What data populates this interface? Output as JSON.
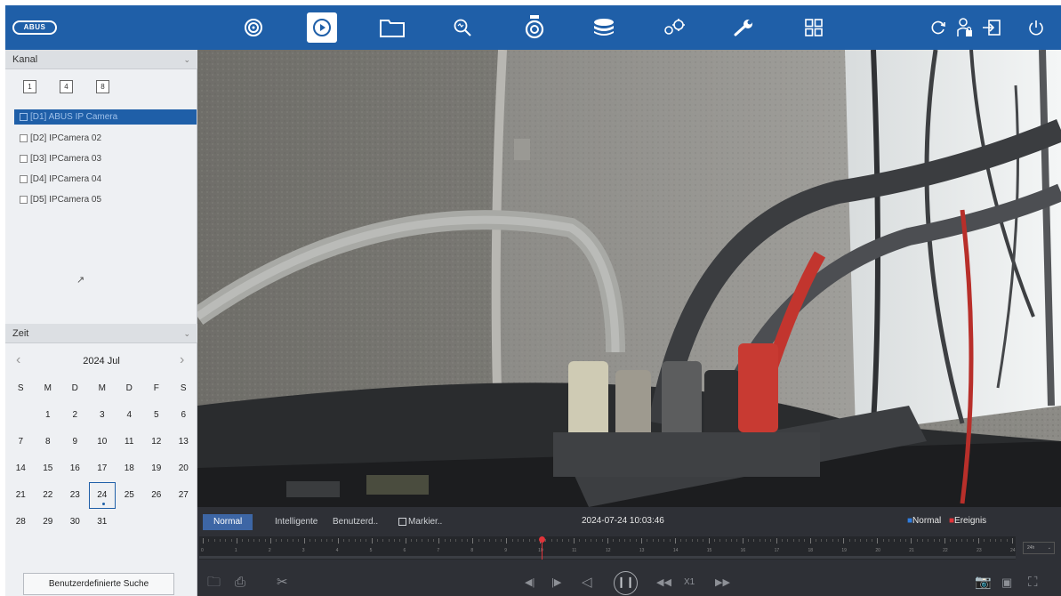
{
  "app": {
    "logo_text": "ABUS"
  },
  "topbar": {
    "icons": [
      {
        "name": "live-view-icon"
      },
      {
        "name": "playback-icon",
        "active": true
      },
      {
        "name": "file-manager-icon"
      },
      {
        "name": "search-icon"
      },
      {
        "name": "camera-icon"
      },
      {
        "name": "storage-icon"
      },
      {
        "name": "settings-icon"
      },
      {
        "name": "maintenance-icon"
      },
      {
        "name": "layout-icon"
      },
      {
        "name": "refresh-icon"
      },
      {
        "name": "user-lock-icon"
      },
      {
        "name": "logout-icon"
      },
      {
        "name": "power-icon"
      }
    ]
  },
  "sidebar": {
    "channel_section": {
      "title": "Kanal",
      "layout_buttons": [
        "1",
        "4",
        "8"
      ],
      "cameras": [
        {
          "label": "[D1] ABUS IP Camera",
          "selected": true
        },
        {
          "label": "[D2] IPCamera 02",
          "selected": false
        },
        {
          "label": "[D3] IPCamera 03",
          "selected": false
        },
        {
          "label": "[D4] IPCamera 04",
          "selected": false
        },
        {
          "label": "[D5] IPCamera 05",
          "selected": false
        }
      ]
    },
    "time_section": {
      "title": "Zeit",
      "month_label": "2024 Jul",
      "weekdays": [
        "S",
        "M",
        "D",
        "M",
        "D",
        "F",
        "S"
      ],
      "weeks": [
        [
          "",
          "1",
          "2",
          "3",
          "4",
          "5",
          "6"
        ],
        [
          "7",
          "8",
          "9",
          "10",
          "11",
          "12",
          "13"
        ],
        [
          "14",
          "15",
          "16",
          "17",
          "18",
          "19",
          "20"
        ],
        [
          "21",
          "22",
          "23",
          "24",
          "25",
          "26",
          "27"
        ],
        [
          "28",
          "29",
          "30",
          "31",
          "",
          "",
          ""
        ]
      ],
      "selected_day": "24"
    },
    "search_button": "Benutzerdefinierte Suche"
  },
  "playback": {
    "modes": [
      "Normal",
      "Intelligente",
      "Benutzerd..",
      "Markier.."
    ],
    "active_mode": "Normal",
    "timestamp": "2024-07-24 10:03:46",
    "legend": [
      {
        "label": "Normal",
        "color": "#2f7de0"
      },
      {
        "label": "Ereignis",
        "color": "#e0343a"
      }
    ],
    "timeline_hours": [
      "0",
      "1",
      "2",
      "3",
      "4",
      "5",
      "6",
      "7",
      "8",
      "9",
      "10",
      "11",
      "12",
      "13",
      "14",
      "15",
      "16",
      "17",
      "18",
      "19",
      "20",
      "21",
      "22",
      "23",
      "24"
    ],
    "timeline_position_hour": 10.06,
    "zoom_option": "24h",
    "speed_label": "X1"
  },
  "colors": {
    "accent": "#1f5fa8",
    "control_bar": "#2e3036",
    "marker": "#e0343a"
  }
}
